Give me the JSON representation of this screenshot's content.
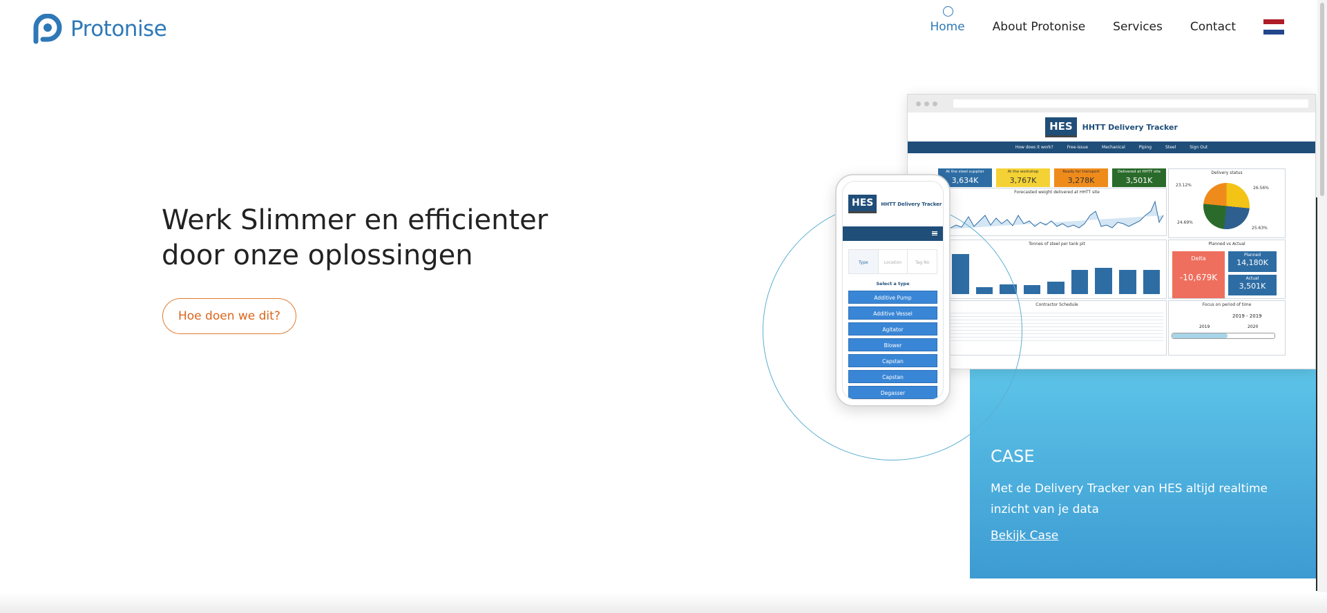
{
  "brand": {
    "name": "Protonise",
    "color": "#2e78b7"
  },
  "nav": {
    "items": [
      {
        "label": "Home",
        "active": true
      },
      {
        "label": "About Protonise",
        "active": false
      },
      {
        "label": "Services",
        "active": false
      },
      {
        "label": "Contact",
        "active": false
      }
    ],
    "language_flag": "netherlands-flag-icon"
  },
  "hero": {
    "title_line1": "Werk Slimmer en efficienter",
    "title_line2": "door onze oplossingen",
    "cta_label": "Hoe doen we dit?",
    "cta_color": "#e07b2c"
  },
  "case": {
    "title": "CASE",
    "text": "Met de Delivery Tracker van HES altijd realtime inzicht van je data",
    "link_label": "Bekijk Case"
  },
  "dashboard": {
    "logo": "HES",
    "title": "HHTT Delivery Tracker",
    "nav": [
      "How does it work?",
      "Free-issue",
      "Mechanical",
      "Piping",
      "Steel",
      "Sign Out"
    ],
    "kpis": [
      {
        "label": "At the steel supplier",
        "value": "3,634K",
        "color": "#2e6da4",
        "text": "#fff"
      },
      {
        "label": "At the workshop",
        "value": "3,767K",
        "color": "#f4d235",
        "text": "#333"
      },
      {
        "label": "Ready for transport",
        "value": "3,278K",
        "color": "#ef8b1b",
        "text": "#333"
      },
      {
        "label": "Delivered at HHTT site",
        "value": "3,501K",
        "color": "#2a6b2b",
        "text": "#fff"
      }
    ],
    "delivery_status": {
      "title": "Delivery status",
      "labels": [
        "23.12%",
        "26.56%",
        "24.69%",
        "25.63%"
      ]
    },
    "forecast_title": "Forecasted weight delivered at HHTT site",
    "tonnes_title": "Tonnes of steel per tank pit",
    "tonnes_values": [
      0.9,
      0.15,
      0.22,
      0.2,
      0.28,
      0.55,
      0.6,
      0.55,
      0.55
    ],
    "planned": {
      "title": "Planned vs Actual",
      "delta_label": "Delta",
      "delta_value": "-10,679K",
      "planned_label": "Planned",
      "planned_value": "14,180K",
      "actual_label": "Actual",
      "actual_value": "3,501K"
    },
    "schedule_title": "Contractor Schedule",
    "focus": {
      "title": "Focus on period of time",
      "range": "2019 - 2019",
      "years": [
        "2019",
        "2020"
      ]
    }
  },
  "phone": {
    "logo": "HES",
    "title": "HHTT Delivery Tracker",
    "tabs": [
      "Type",
      "Location",
      "Tag No"
    ],
    "select_label": "Select a type",
    "types": [
      "Additive Pump",
      "Additive Vessel",
      "Agitator",
      "Blower",
      "Capstan",
      "Capstan",
      "Degasser"
    ]
  }
}
